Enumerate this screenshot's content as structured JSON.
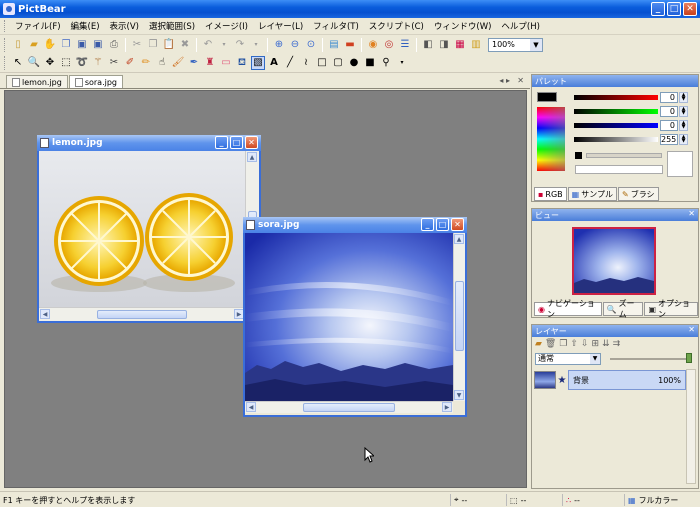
{
  "app": {
    "title": "PictBear"
  },
  "menu": [
    "ファイル(F)",
    "編集(E)",
    "表示(V)",
    "選択範囲(S)",
    "イメージ(I)",
    "レイヤー(L)",
    "フィルタ(T)",
    "スクリプト(C)",
    "ウィンドウ(W)",
    "ヘルプ(H)"
  ],
  "toolbar": {
    "zoom": "100%"
  },
  "doc_tabs": [
    {
      "label": "lemon.jpg",
      "active": false
    },
    {
      "label": "sora.jpg",
      "active": true
    }
  ],
  "windows": {
    "lemon": {
      "title": "lemon.jpg"
    },
    "sora": {
      "title": "sora.jpg"
    }
  },
  "palette": {
    "title": "パレット",
    "r": "0",
    "g": "0",
    "b": "0",
    "a": "255",
    "tabs": [
      "RGB",
      "サンプル",
      "ブラシ"
    ]
  },
  "view": {
    "title": "ビュー",
    "tabs": [
      "ナビゲーション",
      "ズーム",
      "オプション"
    ]
  },
  "layers": {
    "title": "レイヤー",
    "blend_mode": "通常",
    "items": [
      {
        "name": "背景",
        "opacity": "100%"
      }
    ]
  },
  "status": {
    "help": "F1 キーを押すとヘルプを表示します",
    "pos": "--",
    "size": "--",
    "color": "--",
    "mode": "フルカラー"
  },
  "colors": {
    "titlebar": "#0a5ddc",
    "workspace": "#808080",
    "panel_bg": "#ece9d8"
  }
}
